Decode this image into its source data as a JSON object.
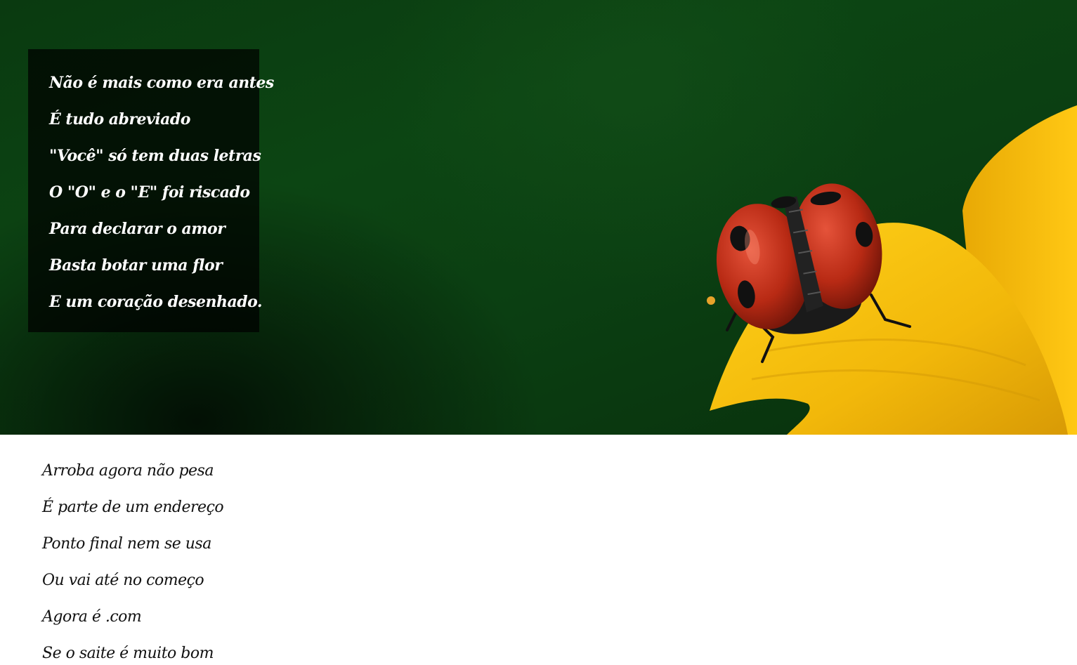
{
  "hero": {
    "image": "ladybug-on-yellow-flower-petal",
    "colors": {
      "background_green": "#0c4513",
      "petal_yellow": "#f5c10a",
      "ladybug_red": "#c8321a"
    },
    "poem_lines": [
      "Não é mais como era antes",
      "É tudo abreviado",
      "\"Você\" só tem duas letras",
      "O \"O\" e o \"E\" foi riscado",
      "Para declarar o amor",
      "Basta botar uma flor",
      "E um coração desenhado."
    ]
  },
  "content": {
    "lines": [
      "Arroba agora não pesa",
      "É parte de um endereço",
      "Ponto final nem se usa",
      "Ou vai até no começo",
      "Agora é .com",
      "Se o saite é muito bom"
    ]
  }
}
